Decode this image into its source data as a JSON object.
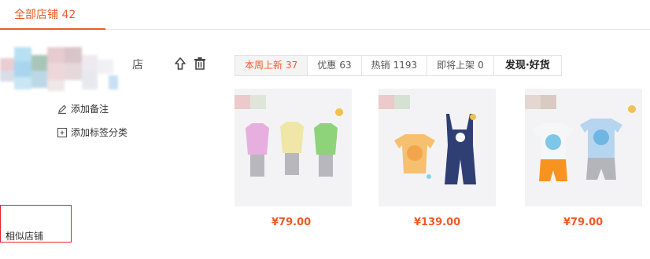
{
  "header": {
    "tab_label": "全部店铺 42"
  },
  "shop": {
    "name_tail": "店",
    "add_note": "添加备注",
    "add_tag": "添加标签分类",
    "similar_link": "相似店铺",
    "similar_arrow": "›"
  },
  "tabs": [
    {
      "label": "本周上新",
      "count": "37"
    },
    {
      "label": "优惠",
      "count": "63"
    },
    {
      "label": "热销",
      "count": "1193"
    },
    {
      "label": "即将上架",
      "count": "0"
    },
    {
      "label": "发现·好货",
      "count": ""
    }
  ],
  "products": [
    {
      "price": "¥79.00"
    },
    {
      "price": "¥139.00"
    },
    {
      "price": "¥79.00"
    }
  ],
  "colors": {
    "accent": "#ef5a28",
    "highlight_box": "#e0242b"
  }
}
